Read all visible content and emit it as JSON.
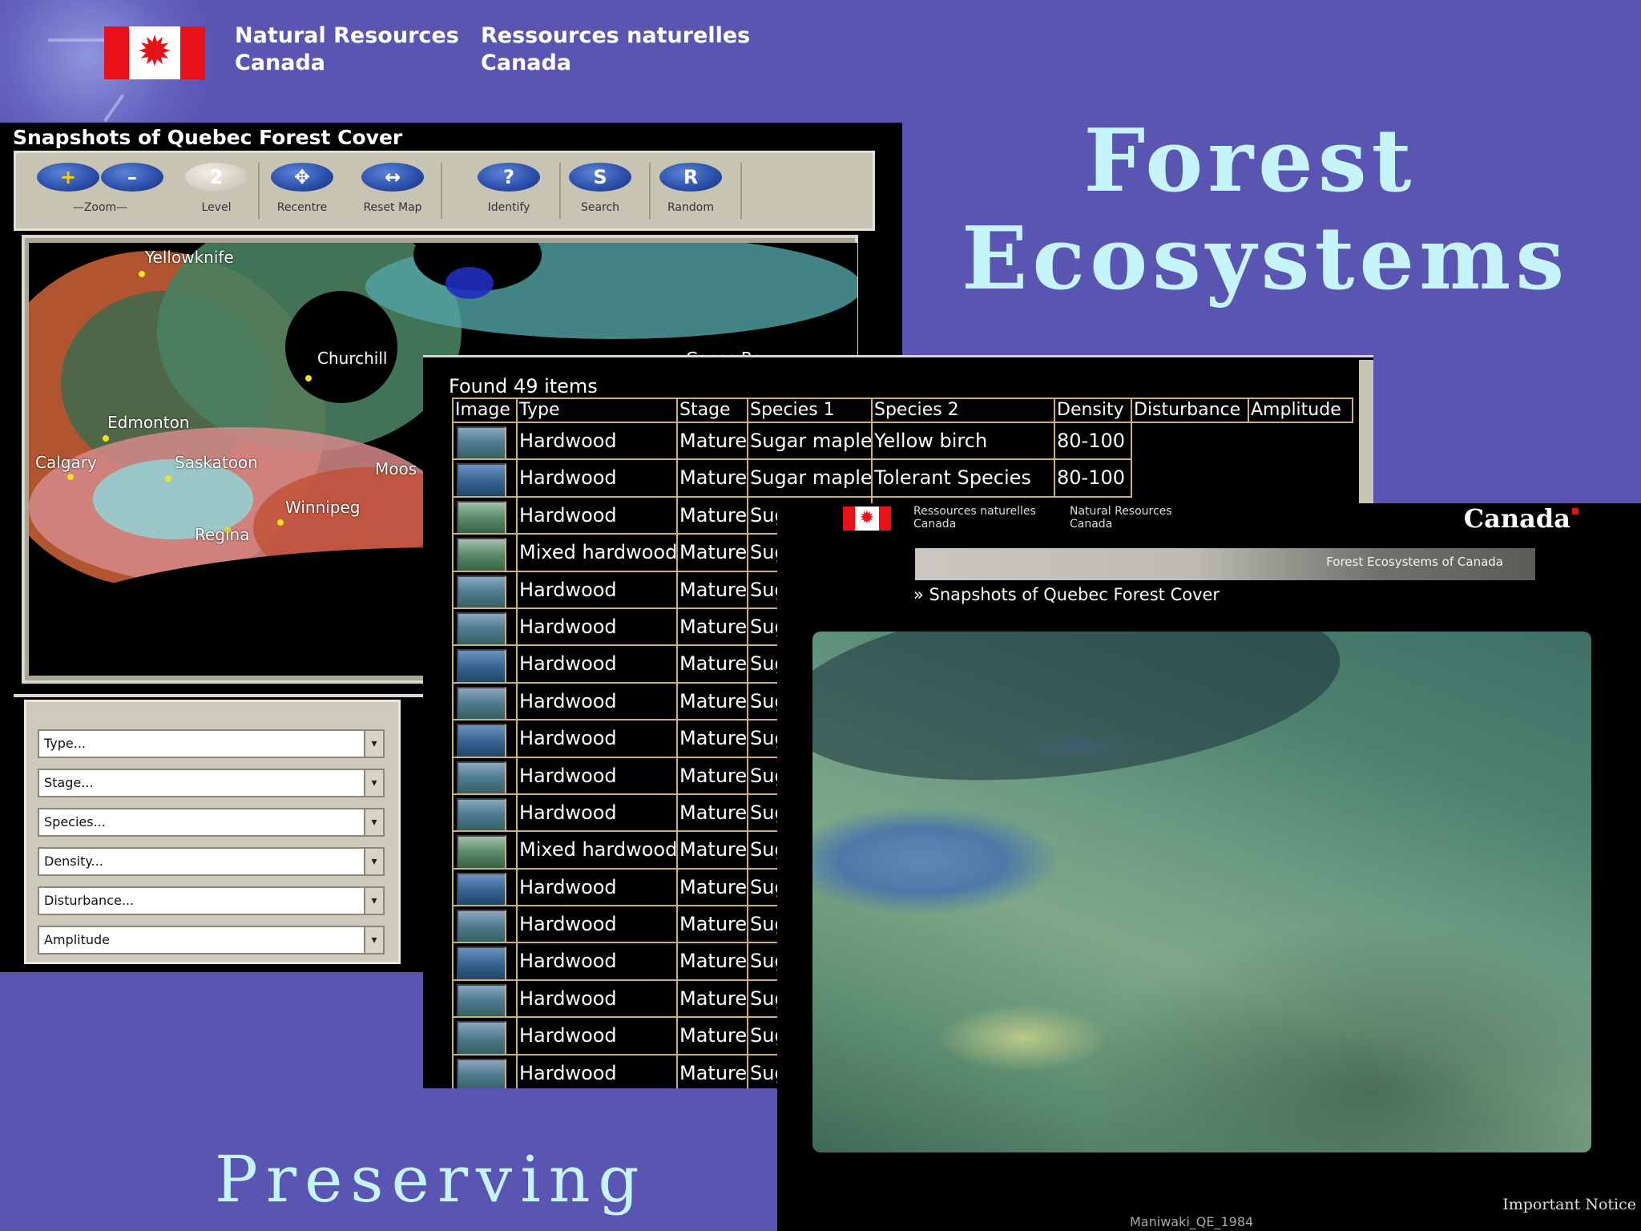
{
  "header": {
    "dept_en_line1": "Natural Resources",
    "dept_en_line2": "Canada",
    "dept_fr_line1": "Ressources naturelles",
    "dept_fr_line2": "Canada",
    "flag_icon": "canada-flag-icon"
  },
  "slide": {
    "title_line1": "Forest",
    "title_line2": "Ecosystems",
    "subtitle": "Preserving"
  },
  "map_app": {
    "title": "Snapshots of Quebec Forest Cover",
    "tools": [
      {
        "symbol": "+",
        "label": "",
        "icon": "zoom-in-icon"
      },
      {
        "symbol": "–",
        "label": "—Zoom—",
        "icon": "zoom-out-icon"
      },
      {
        "symbol": "2",
        "label": "Level",
        "icon": "level-icon"
      },
      {
        "symbol": "✥",
        "label": "Recentre",
        "icon": "recentre-icon"
      },
      {
        "symbol": "↔",
        "label": "Reset Map",
        "icon": "reset-map-icon"
      },
      {
        "symbol": "?",
        "label": "Identify",
        "icon": "identify-icon"
      },
      {
        "symbol": "S",
        "label": "Search",
        "icon": "search-icon"
      },
      {
        "symbol": "R",
        "label": "Random",
        "icon": "random-icon"
      }
    ],
    "cities": [
      "Yellowknife",
      "Churchill",
      "Edmonton",
      "Calgary",
      "Saskatoon",
      "Winnipeg",
      "Regina",
      "Moos",
      "Goose Bay"
    ],
    "filters": [
      "Type...",
      "Stage...",
      "Species...",
      "Density...",
      "Disturbance...",
      "Amplitude"
    ]
  },
  "results": {
    "found_text": "Found 49 items",
    "columns": [
      "Image",
      "Type",
      "Stage",
      "Species 1",
      "Species 2",
      "Density",
      "Disturbance",
      "Amplitude"
    ],
    "rows": [
      {
        "type": "Hardwood",
        "stage": "Mature",
        "species1": "Sugar maple",
        "species2": "Yellow birch",
        "density": "80-100"
      },
      {
        "type": "Hardwood",
        "stage": "Mature",
        "species1": "Sugar maple",
        "species2": "Tolerant Species",
        "density": "80-100"
      },
      {
        "type": "Hardwood",
        "stage": "Mature",
        "species1": "Sug"
      },
      {
        "type": "Mixed hardwood",
        "stage": "Mature",
        "species1": "Sug"
      },
      {
        "type": "Hardwood",
        "stage": "Mature",
        "species1": "Sug"
      },
      {
        "type": "Hardwood",
        "stage": "Mature",
        "species1": "Sug"
      },
      {
        "type": "Hardwood",
        "stage": "Mature",
        "species1": "Sug"
      },
      {
        "type": "Hardwood",
        "stage": "Mature",
        "species1": "Sug"
      },
      {
        "type": "Hardwood",
        "stage": "Mature",
        "species1": "Sug"
      },
      {
        "type": "Hardwood",
        "stage": "Mature",
        "species1": "Sug"
      },
      {
        "type": "Hardwood",
        "stage": "Mature",
        "species1": "Sug"
      },
      {
        "type": "Mixed hardwood",
        "stage": "Mature",
        "species1": "Sug"
      },
      {
        "type": "Hardwood",
        "stage": "Mature",
        "species1": "Sug"
      },
      {
        "type": "Hardwood",
        "stage": "Mature",
        "species1": "Sug"
      },
      {
        "type": "Hardwood",
        "stage": "Mature",
        "species1": "Sug"
      },
      {
        "type": "Hardwood",
        "stage": "Mature",
        "species1": "Sug"
      },
      {
        "type": "Hardwood",
        "stage": "Mature",
        "species1": "Sug"
      },
      {
        "type": "Hardwood",
        "stage": "Mature",
        "species1": "Sug"
      }
    ]
  },
  "photo_page": {
    "dept_fr": "Ressources naturelles",
    "dept_fr2": "Canada",
    "dept_en": "Natural Resources",
    "dept_en2": "Canada",
    "wordmark": "Canada",
    "banner": "Forest Ecosystems of Canada",
    "breadcrumb": "» Snapshots of Quebec Forest Cover",
    "notice": "Important Notice",
    "caption": "Maniwaki_QE_1984"
  },
  "colors": {
    "background": "#5a55b3",
    "title": "#c6f4fb",
    "grid_lines": "#c9b27a",
    "flag_red": "#e8111a"
  }
}
